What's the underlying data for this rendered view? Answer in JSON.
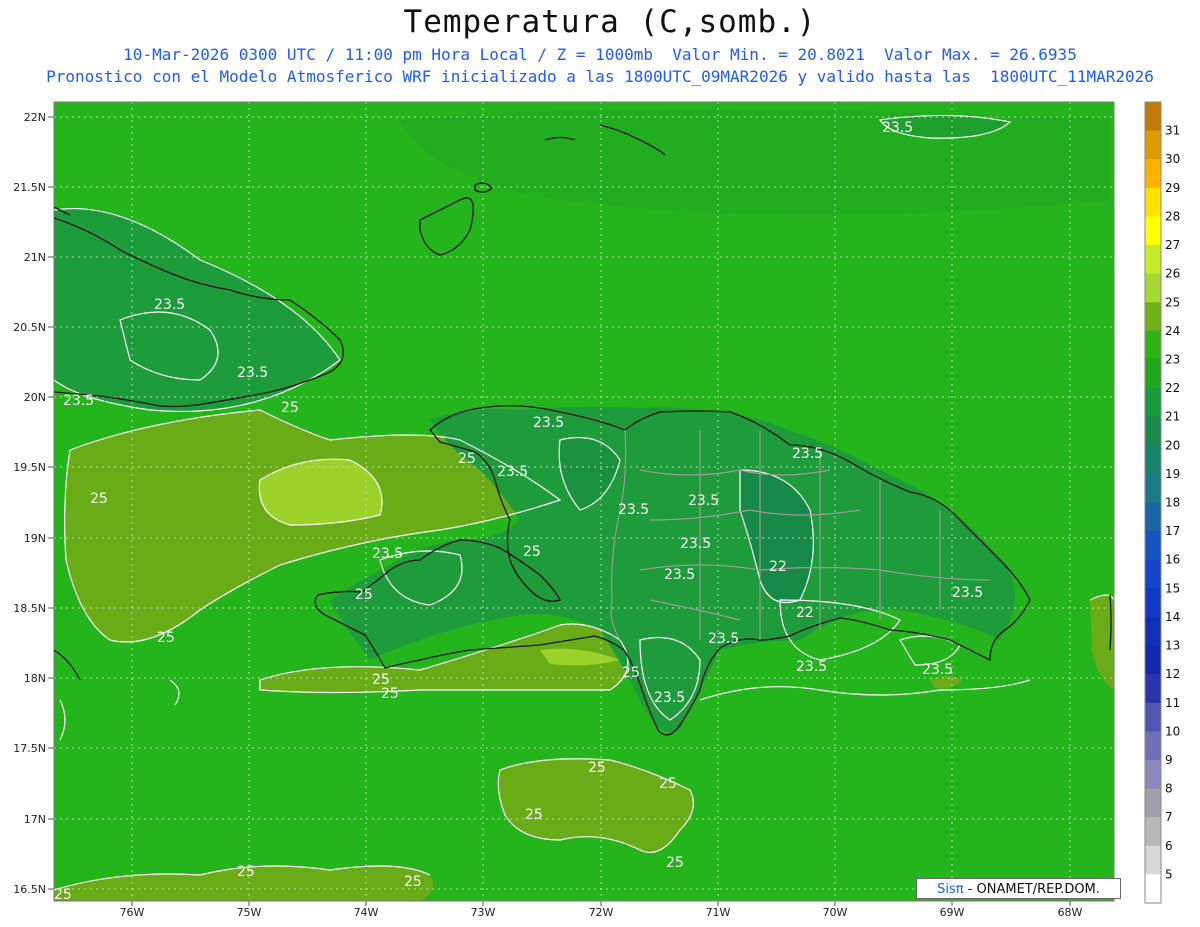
{
  "header": {
    "title": "Temperatura (C,somb.)",
    "subtitle_line1": "10-Mar-2026 0300 UTC / 11:00 pm Hora Local / Z = 1000mb  Valor Min. = 20.8021  Valor Max. = 26.6935",
    "subtitle_line2": "Pronostico con el Modelo Atmosferico WRF inicializado a las 1800UTC_09MAR2026 y valido hasta las  1800UTC_11MAR2026"
  },
  "axes": {
    "latitude_labels": [
      "22N",
      "21.5N",
      "21N",
      "20.5N",
      "20N",
      "19.5N",
      "19N",
      "18.5N",
      "18N",
      "17.5N",
      "17N",
      "16.5N"
    ],
    "longitude_labels": [
      "76W",
      "75W",
      "74W",
      "73W",
      "72W",
      "71W",
      "70W",
      "69W",
      "68W"
    ]
  },
  "contour_labels": [
    "23.5",
    "23.5",
    "23.5",
    "23.5",
    "25",
    "23.5",
    "25",
    "25",
    "23.5",
    "23.5",
    "23.5",
    "25",
    "23.5",
    "25",
    "23.5",
    "25",
    "25",
    "23.5",
    "22",
    "22",
    "23.5",
    "23.5",
    "23.5",
    "25",
    "25",
    "25",
    "25",
    "25",
    "25",
    "25",
    "23.5",
    "23.5",
    "23.5",
    "25",
    "25"
  ],
  "colorbar": {
    "labels": [
      "31",
      "30",
      "29",
      "28",
      "27",
      "26",
      "25",
      "24",
      "23",
      "22",
      "21",
      "20",
      "19",
      "18",
      "17",
      "16",
      "15",
      "14",
      "13",
      "12",
      "11",
      "10",
      "9",
      "8",
      "7",
      "6",
      "5"
    ],
    "colors": [
      "#c07a00",
      "#e09a00",
      "#ffb300",
      "#ffe000",
      "#ffff00",
      "#c4ea28",
      "#a6d832",
      "#6fb219",
      "#2db316",
      "#1fa81c",
      "#169d3a",
      "#1a8a4e",
      "#168468",
      "#177a86",
      "#1666a8",
      "#1454c4",
      "#1444cc",
      "#1238c6",
      "#1030b8",
      "#1428b0",
      "#2a35b0",
      "#5055b0",
      "#7070b4",
      "#8c88bc",
      "#a0a0a8",
      "#b8b8b8",
      "#d8d8d8",
      "#ffffff"
    ]
  },
  "colors": {
    "sea_green": "#24b41c",
    "land_green": "#1e9b3a",
    "warm_zone": "#6aac18",
    "warmest_zone": "#9ad22a",
    "contour": "#ffffff",
    "coast": "#111111",
    "borders": "#9a9a9a",
    "subtitle_blue": "#1e5bff"
  },
  "credit": {
    "brand": "Sisπ",
    "text": " - ONAMET/REP.DOM."
  }
}
